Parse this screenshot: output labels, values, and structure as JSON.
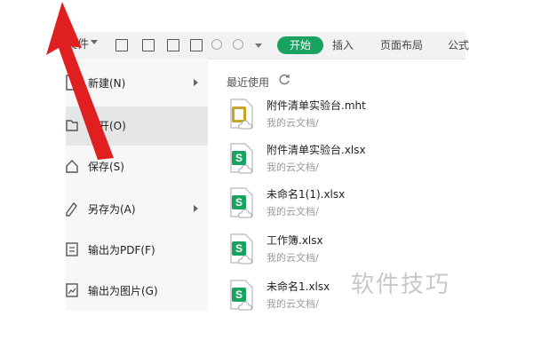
{
  "toolbar": {
    "file_label": "文件",
    "tabs": [
      "开始",
      "插入",
      "页面布局",
      "公式"
    ]
  },
  "menu": {
    "items": [
      {
        "label": "新建(N)",
        "icon": "new-file-icon",
        "has_submenu": true
      },
      {
        "label": "打开(O)",
        "icon": "folder-open-icon",
        "has_submenu": false,
        "active": true
      },
      {
        "label": "保存(S)",
        "icon": "home-save-icon",
        "has_submenu": false
      },
      {
        "label": "另存为(A)",
        "icon": "save-as-icon",
        "has_submenu": true
      },
      {
        "label": "输出为PDF(F)",
        "icon": "pdf-icon",
        "has_submenu": false
      },
      {
        "label": "输出为图片(G)",
        "icon": "image-export-icon",
        "has_submenu": false
      }
    ]
  },
  "recent": {
    "title": "最近使用",
    "files": [
      {
        "name": "附件清单实验台.mht",
        "path": "我的云文档/",
        "type": "mht"
      },
      {
        "name": "附件清单实验台.xlsx",
        "path": "我的云文档/",
        "type": "xlsx"
      },
      {
        "name": "未命名1(1).xlsx",
        "path": "我的云文档/",
        "type": "xlsx"
      },
      {
        "name": "工作簿.xlsx",
        "path": "我的云文档/",
        "type": "xlsx"
      },
      {
        "name": "未命名1.xlsx",
        "path": "我的云文档/",
        "type": "xlsx"
      }
    ]
  },
  "watermark": "软件技巧",
  "colors": {
    "accent_green": "#1aa260",
    "annotation_red": "#e02020",
    "mht_gold": "#c9a227"
  }
}
